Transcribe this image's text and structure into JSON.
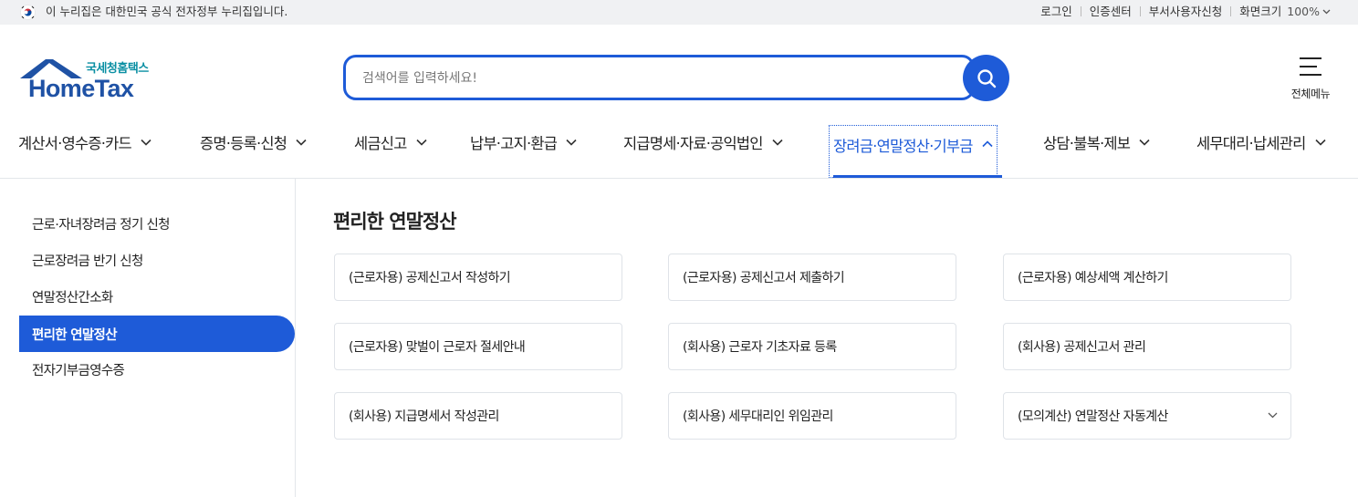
{
  "gov_bar": {
    "notice": "이 누리집은 대한민국 공식 전자정부 누리집입니다.",
    "links": [
      "로그인",
      "인증센터",
      "부서사용자신청"
    ],
    "zoom_label": "화면크기",
    "zoom_value": "100%"
  },
  "logo": {
    "subtitle": "국세청홈택스",
    "name": "HomeTax",
    "brand_color": "#1f52a5",
    "sub_color": "#0a8fa3"
  },
  "search": {
    "placeholder": "검색어를 입력하세요!",
    "value": "",
    "accent": "#1e5bd8"
  },
  "all_menu": {
    "label": "전체메뉴"
  },
  "gnb": {
    "items": [
      {
        "label": "계산서·영수증·카드",
        "icon": "chevron-down-icon"
      },
      {
        "label": "증명·등록·신청",
        "icon": "chevron-down-icon"
      },
      {
        "label": "세금신고",
        "icon": "chevron-down-icon"
      },
      {
        "label": "납부·고지·환급",
        "icon": "chevron-down-icon"
      },
      {
        "label": "지급명세·자료·공익법인",
        "icon": "chevron-down-icon"
      },
      {
        "label": "장려금·연말정산·기부금",
        "icon": "chevron-up-icon",
        "active": true
      },
      {
        "label": "상담·불복·제보",
        "icon": "chevron-down-icon"
      },
      {
        "label": "세무대리·납세관리",
        "icon": "chevron-down-icon"
      }
    ]
  },
  "lnb": {
    "items": [
      {
        "label": "근로·자녀장려금 정기 신청"
      },
      {
        "label": "근로장려금 반기 신청"
      },
      {
        "label": "연말정산간소화"
      },
      {
        "label": "편리한 연말정산",
        "active": true
      },
      {
        "label": "전자기부금영수증"
      }
    ]
  },
  "content": {
    "title": "편리한 연말정산",
    "cards": [
      {
        "label": "(근로자용) 공제신고서 작성하기"
      },
      {
        "label": "(근로자용) 공제신고서 제출하기"
      },
      {
        "label": "(근로자용) 예상세액 계산하기"
      },
      {
        "label": "(근로자용) 맞벌이 근로자 절세안내"
      },
      {
        "label": "(회사용) 근로자 기초자료 등록"
      },
      {
        "label": "(회사용) 공제신고서 관리"
      },
      {
        "label": "(회사용) 지급명세서 작성관리"
      },
      {
        "label": "(회사용) 세무대리인 위임관리"
      },
      {
        "label": "(모의계산) 연말정산 자동계산",
        "icon": "chevron-down-icon"
      }
    ]
  }
}
